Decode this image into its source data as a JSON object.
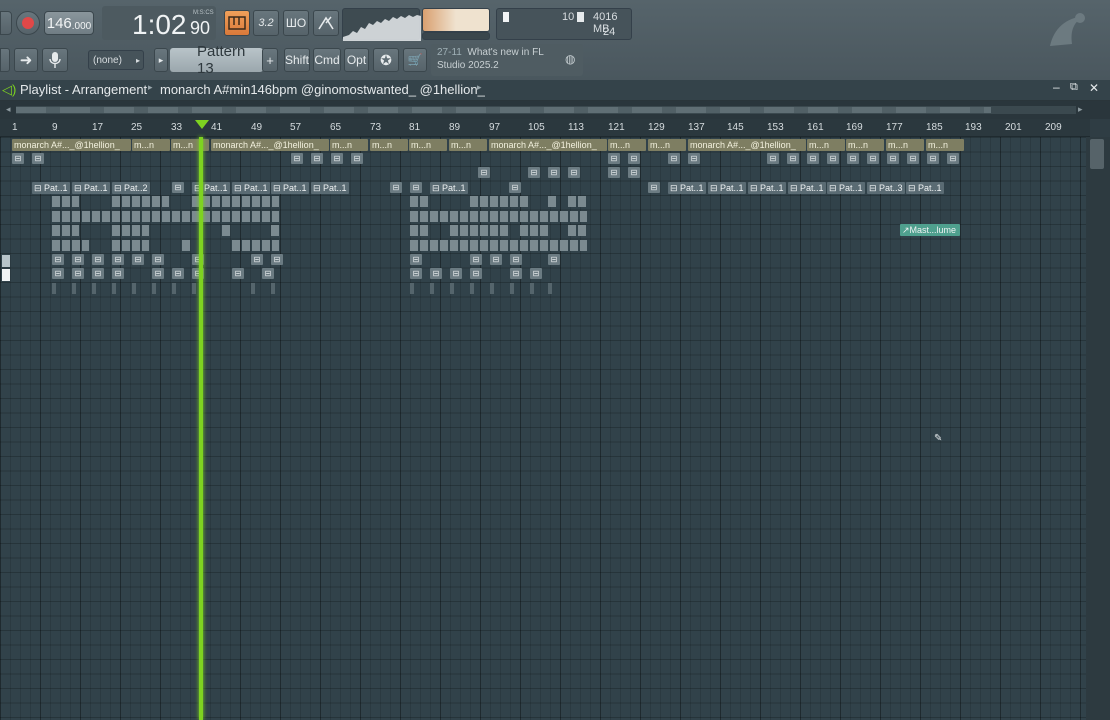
{
  "toolbar": {
    "tempo_main": "146",
    "tempo_frac": ".000",
    "time_main": "1:02",
    "time_small": "90",
    "time_label": "M:S:CS",
    "pattern": "Pattern 13",
    "pattern_plus": "+",
    "input_none": "(none)",
    "shift": "Shift",
    "cmd": "Cmd",
    "opt": "Opt",
    "snap_label": "3.2",
    "polyphony": "10",
    "ram": "4016 MB",
    "cpu": "24",
    "news_date": "27-11",
    "news_line1": "What's new in FL",
    "news_line2": "Studio 2025.2",
    "colors": {
      "accent": "#d9793a",
      "playhead": "#7ed321",
      "audio_clip": "#7e7e62"
    }
  },
  "playlist": {
    "title": "Playlist - Arrangement",
    "track_title": "monarch A#min146bpm @ginomostwanted_ @1hellion_",
    "bars": [
      "1",
      "9",
      "17",
      "25",
      "33",
      "41",
      "49",
      "57",
      "65",
      "73",
      "81",
      "89",
      "97",
      "105",
      "113",
      "121",
      "129",
      "137",
      "145",
      "153",
      "161",
      "169",
      "177",
      "185",
      "193",
      "201",
      "209"
    ],
    "audio_clips": [
      "monarch A#..._@1hellion_",
      "m...n",
      "m...n",
      "monarch A#..._@1hellion_",
      "m...n",
      "m...n",
      "m...n",
      "monarch A#..._@1hellion_",
      "m...n",
      "m...n",
      "m...n",
      "monarch A#..._@1hellion_",
      "m...n",
      "m...n",
      "m...n"
    ],
    "pattern_labels": [
      "Pat..1",
      "Pat..1",
      "Pat..2",
      "Pat..1",
      "Pat..1",
      "Pat..1",
      "Pat..1",
      "Pat..1",
      "Pat..1",
      "Pat..1",
      "Pat..1",
      "Pat..1",
      "Pat..1",
      "Pat..3",
      "Pat..1"
    ],
    "automation_clip": "Mast...lume"
  }
}
